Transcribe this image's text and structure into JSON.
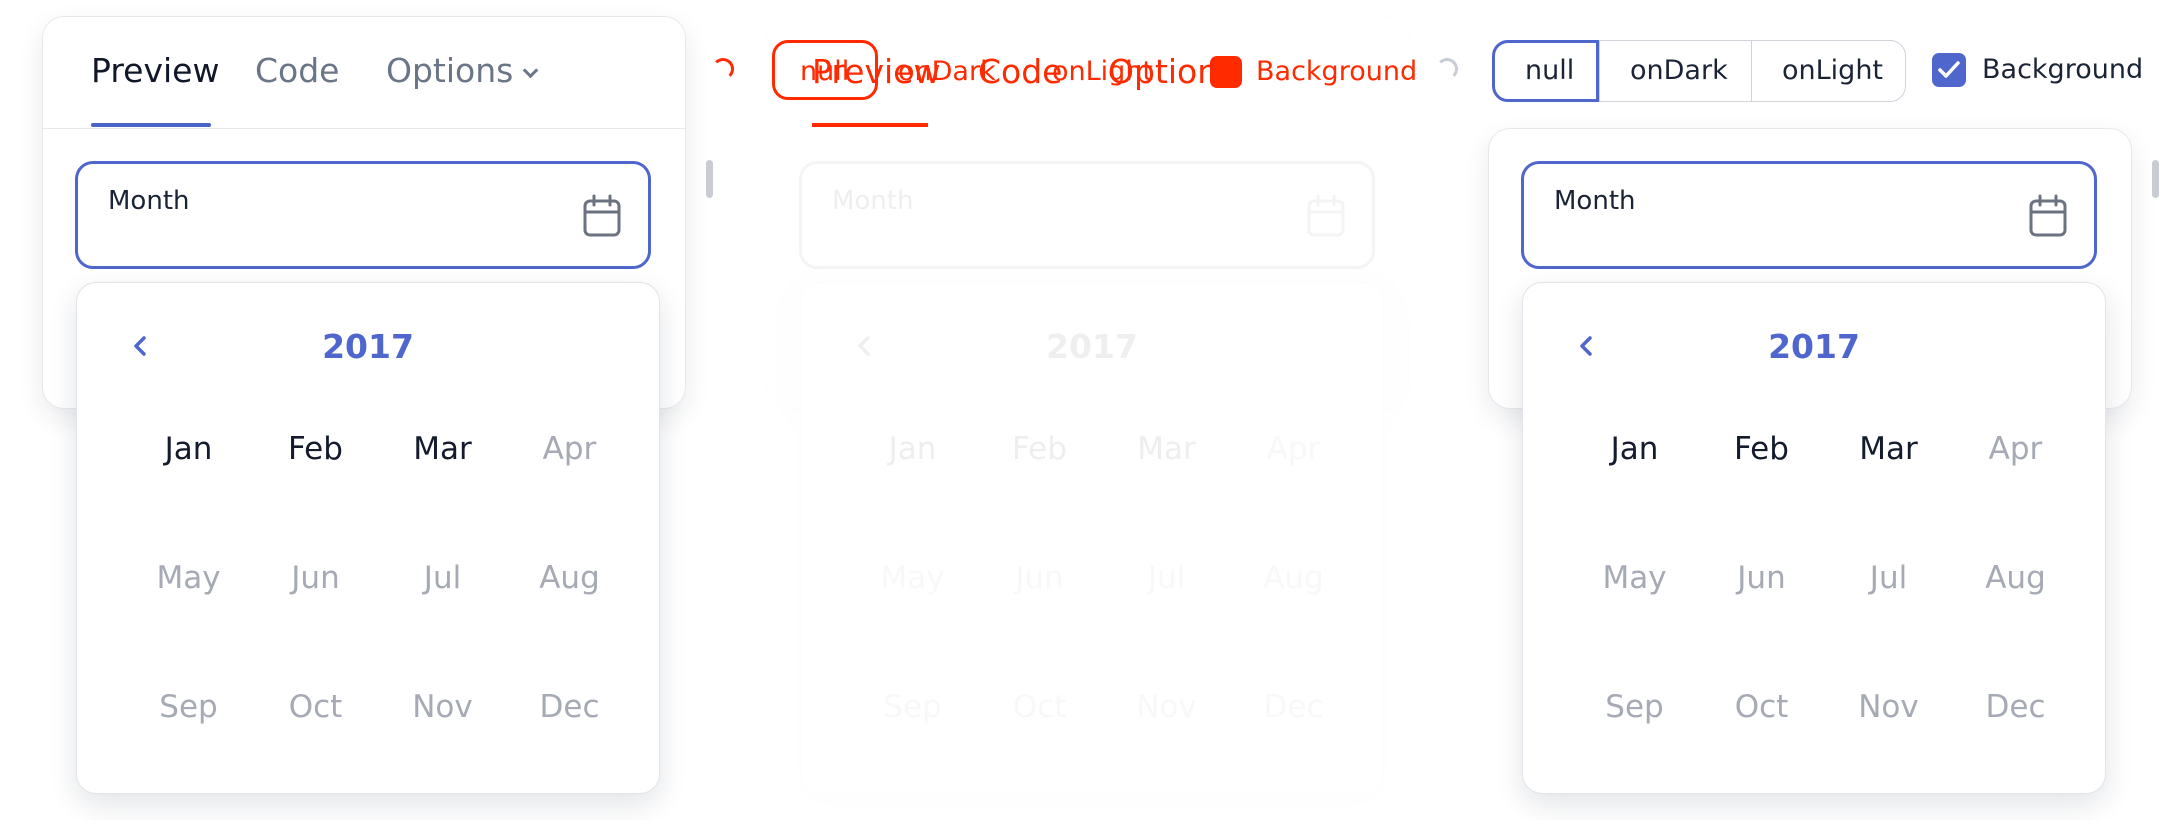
{
  "tabs": {
    "preview": "Preview",
    "code": "Code",
    "options": "Options"
  },
  "field": {
    "label": "Month",
    "value": ""
  },
  "calendar": {
    "year": "2017",
    "months": [
      "Jan",
      "Feb",
      "Mar",
      "Apr",
      "May",
      "Jun",
      "Jul",
      "Aug",
      "Sep",
      "Oct",
      "Nov",
      "Dec"
    ],
    "enabled_count": 3
  },
  "theme_selector": {
    "options": [
      "null",
      "onDark",
      "onLight"
    ],
    "selected": "null"
  },
  "background": {
    "label": "Background",
    "checked": true
  },
  "colors": {
    "accent": "#4f67cc",
    "glitch": "#ff2a00"
  }
}
